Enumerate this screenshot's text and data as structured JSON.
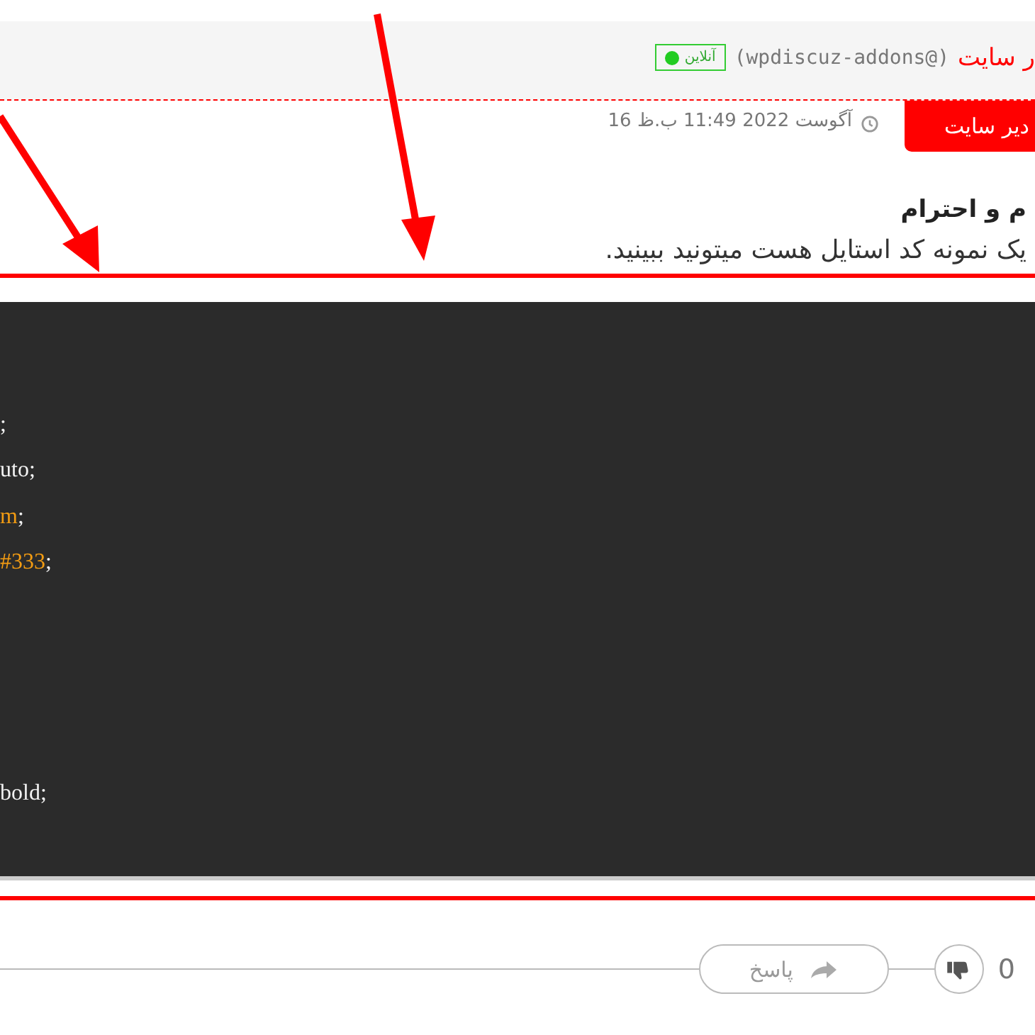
{
  "comment_header": {
    "author": "ر سایت",
    "handle": "(wpdiscuz-addons@)",
    "online_badge": {
      "label": "آنلاین",
      "online": true
    }
  },
  "meta": {
    "role": "دیر سایت",
    "date": "16 آگوست 2022 11:49 ب.ظ"
  },
  "body": {
    "greeting": "م و احترام",
    "sentence": "یک نمونه کد استایل هست میتونید ببینید."
  },
  "code_lines": [
    {
      "kind": "blank"
    },
    {
      "kind": "plain",
      "text": ";"
    },
    {
      "kind": "plain",
      "text": "uto;"
    },
    {
      "kind": "value",
      "value": "m",
      "punct": ";"
    },
    {
      "kind": "value",
      "value": "#333",
      "punct": ";"
    },
    {
      "kind": "blank"
    },
    {
      "kind": "blank"
    },
    {
      "kind": "blank"
    },
    {
      "kind": "blank"
    },
    {
      "kind": "plain",
      "text": "bold;"
    }
  ],
  "footer": {
    "reply_label": "پاسخ",
    "vote_count": "0"
  }
}
